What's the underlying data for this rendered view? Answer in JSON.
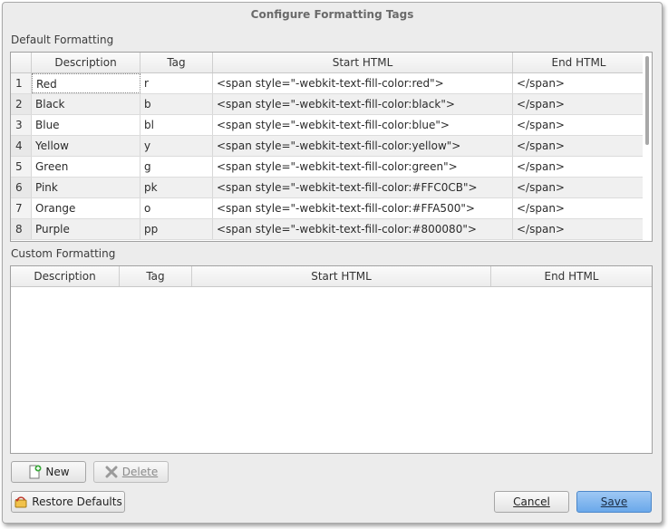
{
  "dialog": {
    "title": "Configure Formatting Tags"
  },
  "default_section": {
    "label": "Default Formatting",
    "columns": [
      "Description",
      "Tag",
      "Start HTML",
      "End HTML"
    ],
    "rows": [
      {
        "num": "1",
        "description": "Red",
        "tag": "r",
        "start": "<span style=\"-webkit-text-fill-color:red\">",
        "end": "</span>"
      },
      {
        "num": "2",
        "description": "Black",
        "tag": "b",
        "start": "<span style=\"-webkit-text-fill-color:black\">",
        "end": "</span>"
      },
      {
        "num": "3",
        "description": "Blue",
        "tag": "bl",
        "start": "<span style=\"-webkit-text-fill-color:blue\">",
        "end": "</span>"
      },
      {
        "num": "4",
        "description": "Yellow",
        "tag": "y",
        "start": "<span style=\"-webkit-text-fill-color:yellow\">",
        "end": "</span>"
      },
      {
        "num": "5",
        "description": "Green",
        "tag": "g",
        "start": "<span style=\"-webkit-text-fill-color:green\">",
        "end": "</span>"
      },
      {
        "num": "6",
        "description": "Pink",
        "tag": "pk",
        "start": "<span style=\"-webkit-text-fill-color:#FFC0CB\">",
        "end": "</span>"
      },
      {
        "num": "7",
        "description": "Orange",
        "tag": "o",
        "start": "<span style=\"-webkit-text-fill-color:#FFA500\">",
        "end": "</span>"
      },
      {
        "num": "8",
        "description": "Purple",
        "tag": "pp",
        "start": "<span style=\"-webkit-text-fill-color:#800080\">",
        "end": "</span>"
      }
    ]
  },
  "custom_section": {
    "label": "Custom Formatting",
    "columns": [
      "Description",
      "Tag",
      "Start HTML",
      "End HTML"
    ]
  },
  "buttons": {
    "new": {
      "label": "New",
      "icon": "new-document-icon"
    },
    "delete": {
      "label": "Delete",
      "icon": "delete-x-icon"
    },
    "restore": {
      "label": "Restore Defaults",
      "icon": "undo-arrow-icon"
    },
    "cancel": {
      "label": "Cancel"
    },
    "save": {
      "label": "Save"
    }
  },
  "colors": {
    "save_accent": "#6aa8ea",
    "new_icon_plus": "#3aa83a"
  }
}
